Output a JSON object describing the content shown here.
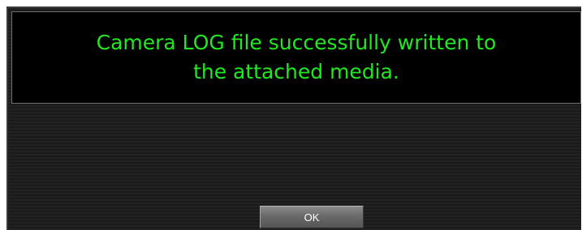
{
  "dialog": {
    "message_lines": [
      "Camera LOG file successfully written to",
      "the attached media."
    ],
    "ok_label": "OK"
  },
  "colors": {
    "message_text": "#22e822",
    "message_background": "#000000",
    "dialog_background": "#202020",
    "button_background": "#6a6a6a",
    "button_text": "#ffffff"
  }
}
